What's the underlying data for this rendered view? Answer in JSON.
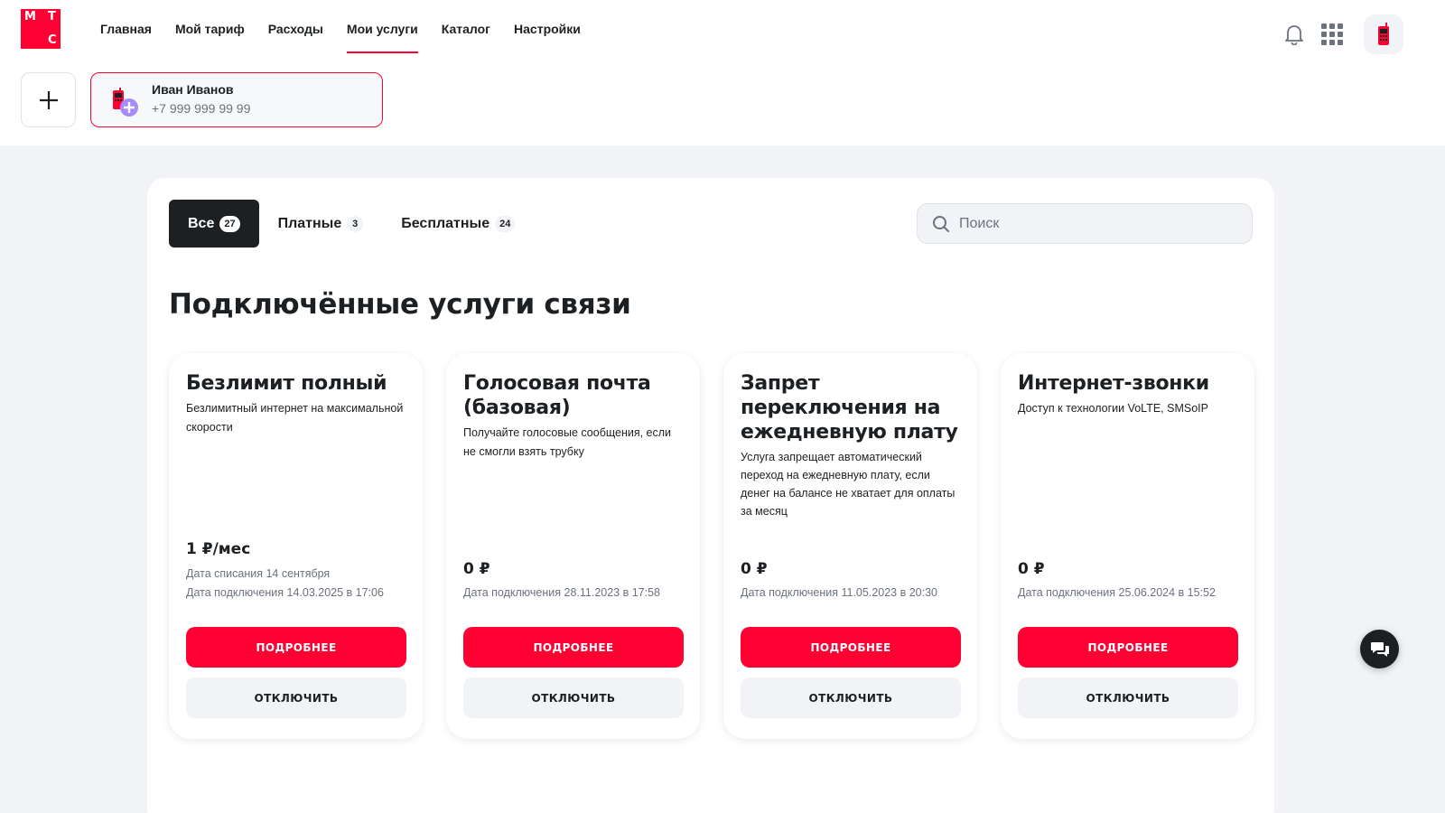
{
  "brand": {
    "logo_letters": [
      "М",
      "Т",
      "С"
    ],
    "accent": "#ff0032",
    "dark": "#1d2023",
    "muted": "#6b727c"
  },
  "nav": {
    "items": [
      {
        "label": "Главная",
        "active": false
      },
      {
        "label": "Мой тариф",
        "active": false
      },
      {
        "label": "Расходы",
        "active": false
      },
      {
        "label": "Мои услуги",
        "active": true
      },
      {
        "label": "Каталог",
        "active": false
      },
      {
        "label": "Настройки",
        "active": false
      }
    ]
  },
  "header_icons": [
    "bell-icon",
    "apps-grid-icon",
    "phone-avatar-icon"
  ],
  "account": {
    "name": "Иван Иванов",
    "phone": "+7 999 999 99 99"
  },
  "tabs": [
    {
      "label": "Все",
      "count": "27",
      "active": true
    },
    {
      "label": "Платные",
      "count": "3",
      "active": false
    },
    {
      "label": "Бесплатные",
      "count": "24",
      "active": false
    }
  ],
  "search": {
    "placeholder": "Поиск",
    "value": ""
  },
  "section_title": "Подключённые услуги связи",
  "cards": [
    {
      "title": "Безлимит полный",
      "description": "Безлимитный интернет на максимальной скорости",
      "price": "1 ₽/мес",
      "charge_date": "Дата списания 14 сентября",
      "connected": "Дата подключения 14.03.2025 в 17:06",
      "details_label": "ПОДРОБНЕЕ",
      "disable_label": "ОТКЛЮЧИТЬ"
    },
    {
      "title": "Голосовая почта (базовая)",
      "description": "Получайте голосовые сообщения, если не смогли взять трубку",
      "price": "0 ₽",
      "connected": "Дата подключения 28.11.2023 в 17:58",
      "details_label": "ПОДРОБНЕЕ",
      "disable_label": "ОТКЛЮЧИТЬ"
    },
    {
      "title": "Запрет переключения на ежедневную плату",
      "description": "Услуга запрещает автоматический переход на ежедневную плату, если денег на балансе не хватает для оплаты за месяц",
      "price": "0 ₽",
      "connected": "Дата подключения 11.05.2023 в 20:30",
      "details_label": "ПОДРОБНЕЕ",
      "disable_label": "ОТКЛЮЧИТЬ"
    },
    {
      "title": "Интернет-звонки",
      "description": "Доступ к технологии VoLTE, SMSoIP",
      "price": "0 ₽",
      "connected": "Дата подключения 25.06.2024 в 15:52",
      "details_label": "ПОДРОБНЕЕ",
      "disable_label": "ОТКЛЮЧИТЬ"
    }
  ]
}
